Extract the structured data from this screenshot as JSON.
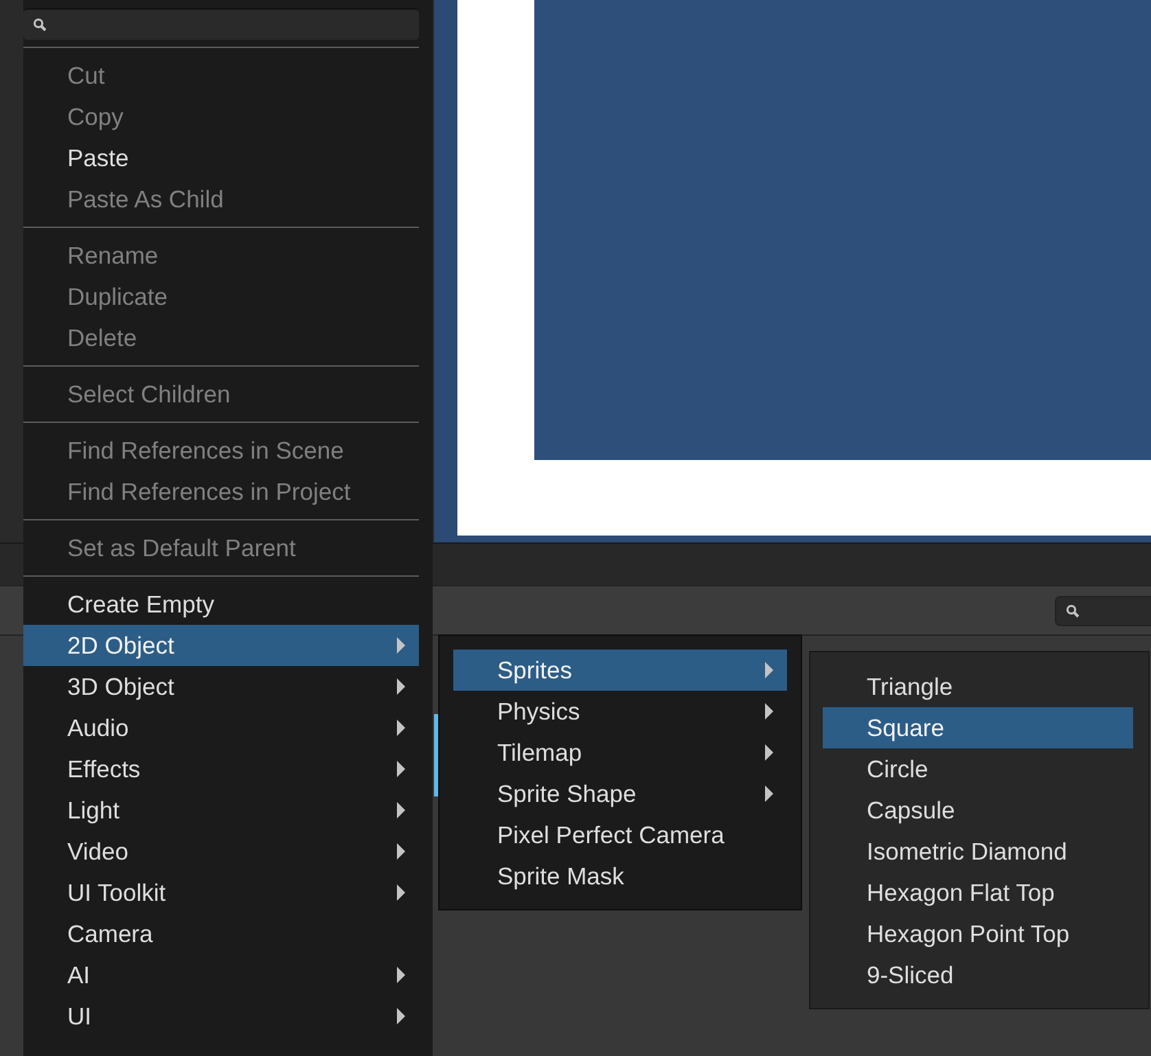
{
  "context_menu": {
    "items": [
      {
        "kind": "item",
        "label": "Cut",
        "disabled": true,
        "selected": false,
        "submenu": false
      },
      {
        "kind": "item",
        "label": "Copy",
        "disabled": true,
        "selected": false,
        "submenu": false
      },
      {
        "kind": "item",
        "label": "Paste",
        "disabled": false,
        "selected": false,
        "submenu": false
      },
      {
        "kind": "item",
        "label": "Paste As Child",
        "disabled": true,
        "selected": false,
        "submenu": false
      },
      {
        "kind": "separator"
      },
      {
        "kind": "item",
        "label": "Rename",
        "disabled": true,
        "selected": false,
        "submenu": false
      },
      {
        "kind": "item",
        "label": "Duplicate",
        "disabled": true,
        "selected": false,
        "submenu": false
      },
      {
        "kind": "item",
        "label": "Delete",
        "disabled": true,
        "selected": false,
        "submenu": false
      },
      {
        "kind": "separator"
      },
      {
        "kind": "item",
        "label": "Select Children",
        "disabled": true,
        "selected": false,
        "submenu": false
      },
      {
        "kind": "separator"
      },
      {
        "kind": "item",
        "label": "Find References in Scene",
        "disabled": true,
        "selected": false,
        "submenu": false
      },
      {
        "kind": "item",
        "label": "Find References in Project",
        "disabled": true,
        "selected": false,
        "submenu": false
      },
      {
        "kind": "separator"
      },
      {
        "kind": "item",
        "label": "Set as Default Parent",
        "disabled": true,
        "selected": false,
        "submenu": false
      },
      {
        "kind": "separator"
      },
      {
        "kind": "item",
        "label": "Create Empty",
        "disabled": false,
        "selected": false,
        "submenu": false
      },
      {
        "kind": "item",
        "label": "2D Object",
        "disabled": false,
        "selected": true,
        "submenu": true
      },
      {
        "kind": "item",
        "label": "3D Object",
        "disabled": false,
        "selected": false,
        "submenu": true
      },
      {
        "kind": "item",
        "label": "Audio",
        "disabled": false,
        "selected": false,
        "submenu": true
      },
      {
        "kind": "item",
        "label": "Effects",
        "disabled": false,
        "selected": false,
        "submenu": true
      },
      {
        "kind": "item",
        "label": "Light",
        "disabled": false,
        "selected": false,
        "submenu": true
      },
      {
        "kind": "item",
        "label": "Video",
        "disabled": false,
        "selected": false,
        "submenu": true
      },
      {
        "kind": "item",
        "label": "UI Toolkit",
        "disabled": false,
        "selected": false,
        "submenu": true
      },
      {
        "kind": "item",
        "label": "Camera",
        "disabled": false,
        "selected": false,
        "submenu": false
      },
      {
        "kind": "item",
        "label": "AI",
        "disabled": false,
        "selected": false,
        "submenu": true
      },
      {
        "kind": "item",
        "label": "UI",
        "disabled": false,
        "selected": false,
        "submenu": true
      }
    ]
  },
  "submenu_2d": {
    "items": [
      {
        "kind": "item",
        "label": "Sprites",
        "disabled": false,
        "selected": true,
        "submenu": true
      },
      {
        "kind": "item",
        "label": "Physics",
        "disabled": false,
        "selected": false,
        "submenu": true
      },
      {
        "kind": "item",
        "label": "Tilemap",
        "disabled": false,
        "selected": false,
        "submenu": true
      },
      {
        "kind": "item",
        "label": "Sprite Shape",
        "disabled": false,
        "selected": false,
        "submenu": true
      },
      {
        "kind": "item",
        "label": "Pixel Perfect Camera",
        "disabled": false,
        "selected": false,
        "submenu": false
      },
      {
        "kind": "item",
        "label": "Sprite Mask",
        "disabled": false,
        "selected": false,
        "submenu": false
      }
    ]
  },
  "submenu_sprites": {
    "items": [
      {
        "kind": "item",
        "label": "Triangle",
        "disabled": false,
        "selected": false,
        "submenu": false
      },
      {
        "kind": "item",
        "label": "Square",
        "disabled": false,
        "selected": true,
        "submenu": false
      },
      {
        "kind": "item",
        "label": "Circle",
        "disabled": false,
        "selected": false,
        "submenu": false
      },
      {
        "kind": "item",
        "label": "Capsule",
        "disabled": false,
        "selected": false,
        "submenu": false
      },
      {
        "kind": "item",
        "label": "Isometric Diamond",
        "disabled": false,
        "selected": false,
        "submenu": false
      },
      {
        "kind": "item",
        "label": "Hexagon Flat Top",
        "disabled": false,
        "selected": false,
        "submenu": false
      },
      {
        "kind": "item",
        "label": "Hexagon Point Top",
        "disabled": false,
        "selected": false,
        "submenu": false
      },
      {
        "kind": "item",
        "label": "9-Sliced",
        "disabled": false,
        "selected": false,
        "submenu": false
      }
    ]
  }
}
